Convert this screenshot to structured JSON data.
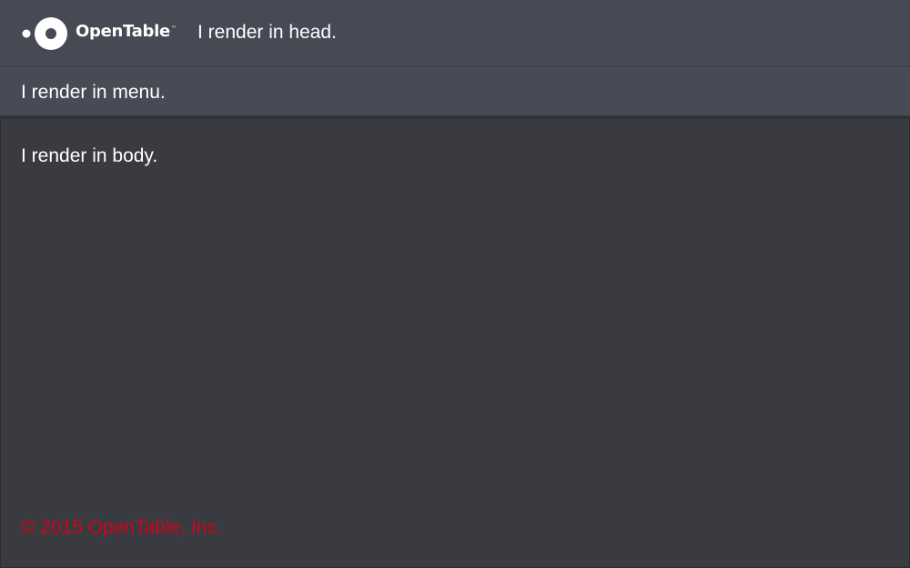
{
  "header": {
    "logo_text": "OpenTable",
    "logo_tm": "™",
    "text": "I render in head."
  },
  "menu": {
    "text": "I render in menu."
  },
  "body": {
    "text": "I render in body."
  },
  "footer": {
    "copyright": "© 2015 OpenTable, Inc."
  },
  "colors": {
    "header_bg": "#464a55",
    "menu_bg": "#474b56",
    "body_bg": "#3a3b40",
    "text": "#ffffff",
    "copyright": "#d0021b"
  },
  "icons": {
    "logo": "opentable-logo-icon"
  }
}
